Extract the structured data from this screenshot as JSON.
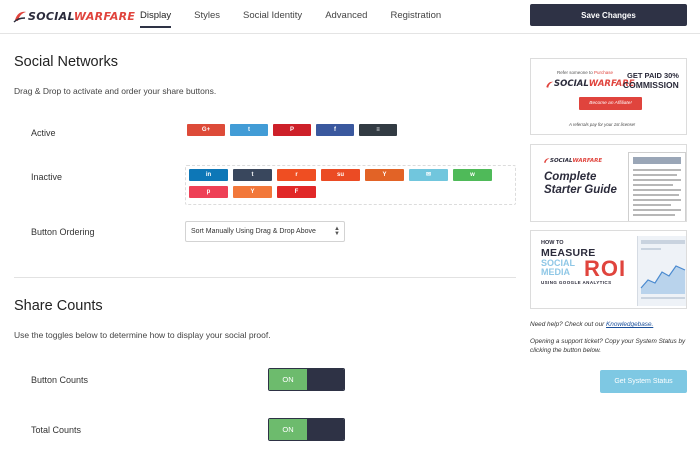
{
  "header": {
    "logo_prefix": "S",
    "logo_mid": "OCIAL",
    "logo_suffix": "WARFARE",
    "tabs": [
      {
        "label": "Display",
        "active": true
      },
      {
        "label": "Styles"
      },
      {
        "label": "Social Identity"
      },
      {
        "label": "Advanced"
      },
      {
        "label": "Registration"
      }
    ],
    "save_label": "Save Changes"
  },
  "social_networks": {
    "title": "Social Networks",
    "description": "Drag & Drop to activate and order your share buttons.",
    "active_label": "Active",
    "inactive_label": "Inactive",
    "active_buttons": [
      {
        "network": "google-plus",
        "glyph": "G+",
        "color": "#dd4b39"
      },
      {
        "network": "twitter",
        "glyph": "t",
        "color": "#429cd6"
      },
      {
        "network": "pinterest",
        "glyph": "P",
        "color": "#cd2029"
      },
      {
        "network": "facebook",
        "glyph": "f",
        "color": "#3a589e"
      },
      {
        "network": "buffer",
        "glyph": "≡",
        "color": "#323b43"
      }
    ],
    "inactive_buttons": [
      {
        "network": "linkedin",
        "glyph": "in",
        "color": "#0d77b7"
      },
      {
        "network": "tumblr",
        "glyph": "t",
        "color": "#39475d"
      },
      {
        "network": "reddit",
        "glyph": "r",
        "color": "#ef4e22"
      },
      {
        "network": "stumbleupon",
        "glyph": "su",
        "color": "#eb4b24"
      },
      {
        "network": "yummly",
        "glyph": "Y",
        "color": "#e26326"
      },
      {
        "network": "email",
        "glyph": "✉",
        "color": "#71c6dd"
      },
      {
        "network": "whatsapp",
        "glyph": "w",
        "color": "#4fba59"
      },
      {
        "network": "pocket",
        "glyph": "p",
        "color": "#ee4056"
      },
      {
        "network": "hacker-news",
        "glyph": "Y",
        "color": "#f2783a"
      },
      {
        "network": "flipboard",
        "glyph": "F",
        "color": "#e12828"
      }
    ],
    "ordering_label": "Button Ordering",
    "ordering_value": "Sort Manually Using Drag & Drop Above"
  },
  "share_counts": {
    "title": "Share Counts",
    "description": "Use the toggles below to determine how to display your social proof.",
    "button_counts_label": "Button Counts",
    "button_counts_state": "ON",
    "total_counts_label": "Total Counts",
    "total_counts_state": "ON"
  },
  "sidebar": {
    "promo1": {
      "small_text_pre": "Refer someone to ",
      "small_text_red": "Purchase",
      "logo_prefix": "S",
      "logo_mid": "OCIAL",
      "logo_suffix": "WARFARE",
      "get_text": "GET PAID 30%",
      "commission_text": "COMMISSION",
      "cta": "Become an Affiliate!",
      "footer": "A referrals pay for your 1st license!"
    },
    "promo2": {
      "logo_prefix": "S",
      "logo_mid": "OCIAL",
      "logo_suffix": "WARFARE",
      "title_line1": "Complete",
      "title_line2": "Starter Guide"
    },
    "promo3": {
      "how_to": "HOW TO",
      "measure": "MEASURE",
      "social": "SOCIAL",
      "media": "MEDIA",
      "roi": "ROI",
      "using": "USING GOOGLE ANALYTICS"
    },
    "help_pre": "Need help? Check out our ",
    "help_link": "Knowledgebase.",
    "support_text": "Opening a support ticket? Copy your System Status by clicking the button below.",
    "system_status_label": "Get System Status"
  }
}
